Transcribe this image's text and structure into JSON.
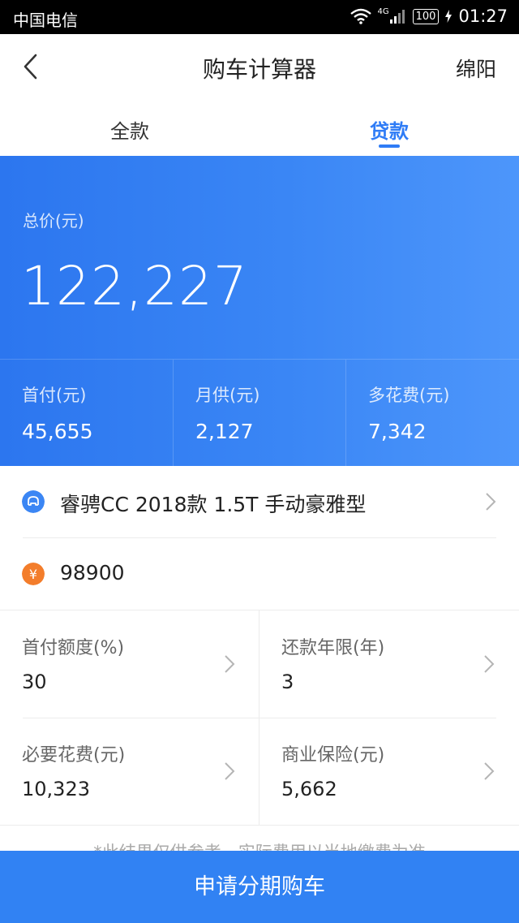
{
  "status_bar": {
    "carrier": "中国电信",
    "network": "4G",
    "battery": "100",
    "time": "01:27"
  },
  "header": {
    "title": "购车计算器",
    "city": "绵阳"
  },
  "tabs": [
    {
      "label": "全款",
      "active": false
    },
    {
      "label": "贷款",
      "active": true
    }
  ],
  "summary": {
    "total_label": "总价(元)",
    "total_value": "122,227",
    "stats": [
      {
        "label": "首付(元)",
        "value": "45,655"
      },
      {
        "label": "月供(元)",
        "value": "2,127"
      },
      {
        "label": "多花费(元)",
        "value": "7,342"
      }
    ]
  },
  "car": {
    "model": "睿骋CC 2018款 1.5T 手动豪雅型",
    "price": "98900",
    "icons": {
      "model": "car-brand-icon",
      "price": "yuan-icon"
    }
  },
  "params": [
    {
      "label": "首付额度(%)",
      "value": "30"
    },
    {
      "label": "还款年限(年)",
      "value": "3"
    },
    {
      "label": "必要花费(元)",
      "value": "10,323"
    },
    {
      "label": "商业保险(元)",
      "value": "5,662"
    }
  ],
  "disclaimer": "*此结果仅供参考，实际费用以当地缴费为准",
  "apply_button": "申请分期购车",
  "colors": {
    "accent": "#2f7cf6",
    "hero": "#3a86f5",
    "orange": "#f37d2b"
  }
}
